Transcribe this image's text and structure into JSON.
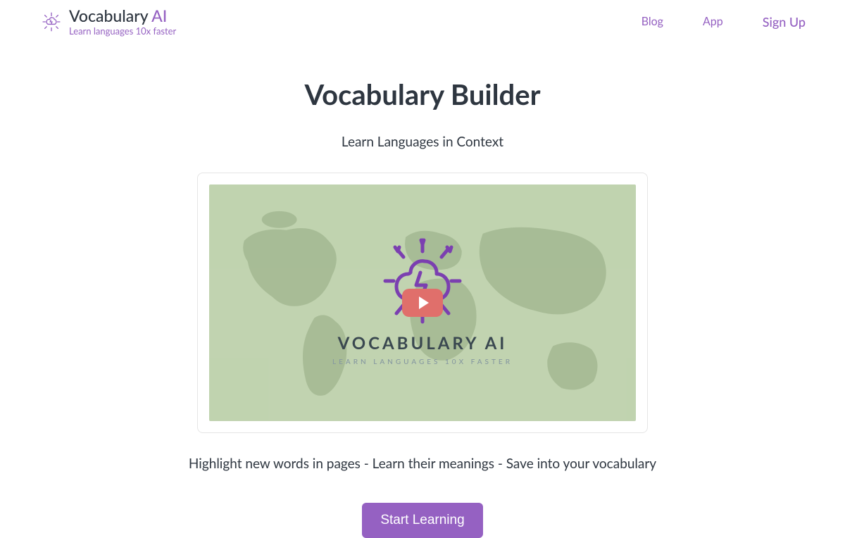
{
  "brand": {
    "name_part1": "Vocabulary",
    "name_part2": "AI",
    "tagline": "Learn languages 10x faster"
  },
  "nav": {
    "items": [
      {
        "label": "Blog"
      },
      {
        "label": "App"
      },
      {
        "label": "Sign Up"
      }
    ]
  },
  "hero": {
    "title": "Vocabulary Builder",
    "subtitle": "Learn Languages in Context",
    "description": "Highlight new words in pages - Learn their meanings - Save into your vocabulary",
    "cta_label": "Start Learning"
  },
  "video": {
    "title": "VOCABULARY AI",
    "subtitle": "LEARN LANGUAGES 10X FASTER"
  },
  "colors": {
    "accent": "#9561c2",
    "play_button": "#e06f6b",
    "video_bg": "#c1d3b0"
  }
}
